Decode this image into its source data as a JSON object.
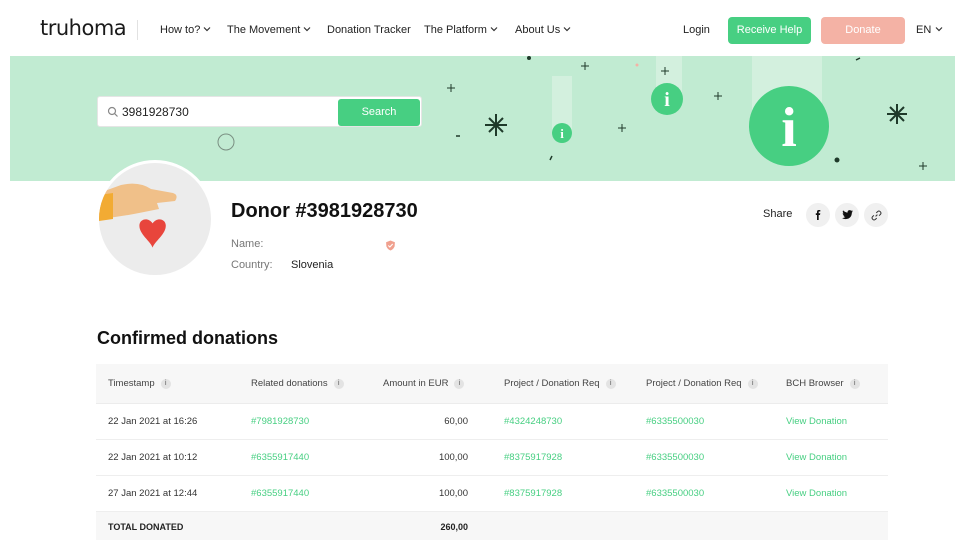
{
  "nav": {
    "logo": "truhoma",
    "items": [
      {
        "label": "How to?",
        "dropdown": true
      },
      {
        "label": "The Movement",
        "dropdown": true
      },
      {
        "label": "Donation Tracker",
        "dropdown": false
      },
      {
        "label": "The Platform",
        "dropdown": true
      },
      {
        "label": "About Us",
        "dropdown": true
      }
    ],
    "login": "Login",
    "receive_help": "Receive Help",
    "donate": "Donate",
    "language": "EN"
  },
  "search": {
    "value": "3981928730",
    "button": "Search"
  },
  "donor": {
    "title": "Donor #3981928730",
    "name_label": "Name:",
    "name_value": "",
    "country_label": "Country:",
    "country_value": "Slovenia"
  },
  "share": {
    "label": "Share",
    "icons": [
      "facebook-icon",
      "twitter-icon",
      "link-icon"
    ]
  },
  "donations": {
    "title": "Confirmed donations",
    "columns": [
      "Timestamp",
      "Related donations",
      "Amount in EUR",
      "Project / Donation Req",
      "Project / Donation Req",
      "BCH Browser"
    ],
    "rows": [
      [
        "22 Jan 2021 at 16:26",
        "#7981928730",
        "60,00",
        "#4324248730",
        "#6335500030",
        "View Donation"
      ],
      [
        "22 Jan 2021 at 10:12",
        "#6355917440",
        "100,00",
        "#8375917928",
        "#6335500030",
        "View Donation"
      ],
      [
        "27 Jan 2021 at 12:44",
        "#6355917440",
        "100,00",
        "#8375917928",
        "#6335500030",
        "View Donation"
      ]
    ],
    "total_label": "TOTAL DONATED",
    "total_value": "260,00"
  },
  "colors": {
    "accent": "#47cf82",
    "donate": "#f4b2a5",
    "hero_bg": "#c1ebd2",
    "heart": "#e8453c"
  }
}
